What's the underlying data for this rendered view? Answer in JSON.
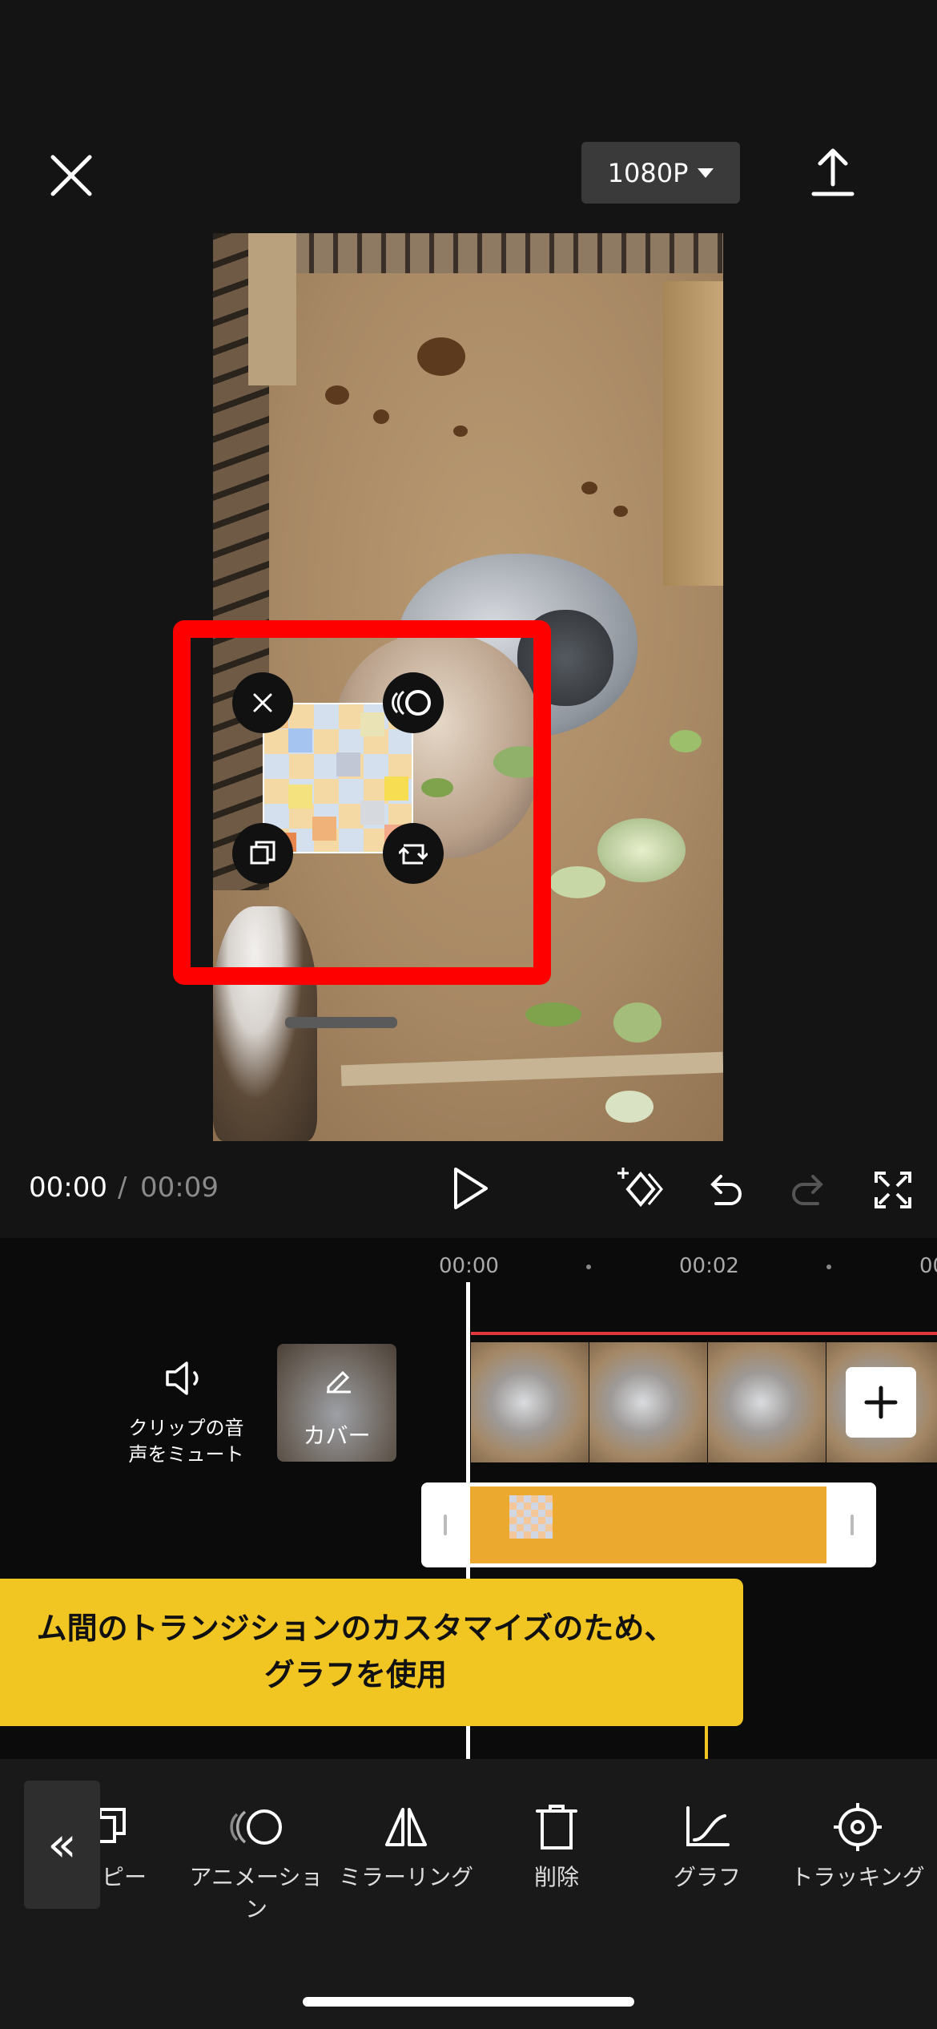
{
  "header": {
    "resolution": "1080P",
    "icons": {
      "close": "close-icon",
      "export": "upload-icon"
    }
  },
  "preview": {
    "sticker_icons": [
      "remove-icon",
      "animation-icon",
      "duplicate-icon",
      "rotate-resize-icon"
    ],
    "highlight_color": "#ff0000"
  },
  "playback": {
    "current_time": "00:00",
    "separator": "/",
    "total_time": "00:09"
  },
  "timeline": {
    "ruler": [
      "00:00",
      "00:02",
      "00"
    ],
    "mute_label": "クリップの音声をミュート",
    "cover_label": "カバー"
  },
  "tooltip": {
    "line1": "ム間のトランジションのカスタマイズのため、",
    "line2": "グラフを使用"
  },
  "toolbar": {
    "collapse": "«",
    "items": [
      {
        "label": "ピー",
        "icon": "copy-icon"
      },
      {
        "label": "アニメーション",
        "icon": "animation-icon"
      },
      {
        "label": "ミラーリング",
        "icon": "mirror-icon"
      },
      {
        "label": "削除",
        "icon": "delete-icon"
      },
      {
        "label": "グラフ",
        "icon": "graph-icon"
      },
      {
        "label": "トラッキング",
        "icon": "tracking-icon"
      }
    ]
  },
  "colors": {
    "accent_yellow": "#f2c622",
    "sticker_track": "#eba92f",
    "clip_marker": "#e23a3a"
  }
}
